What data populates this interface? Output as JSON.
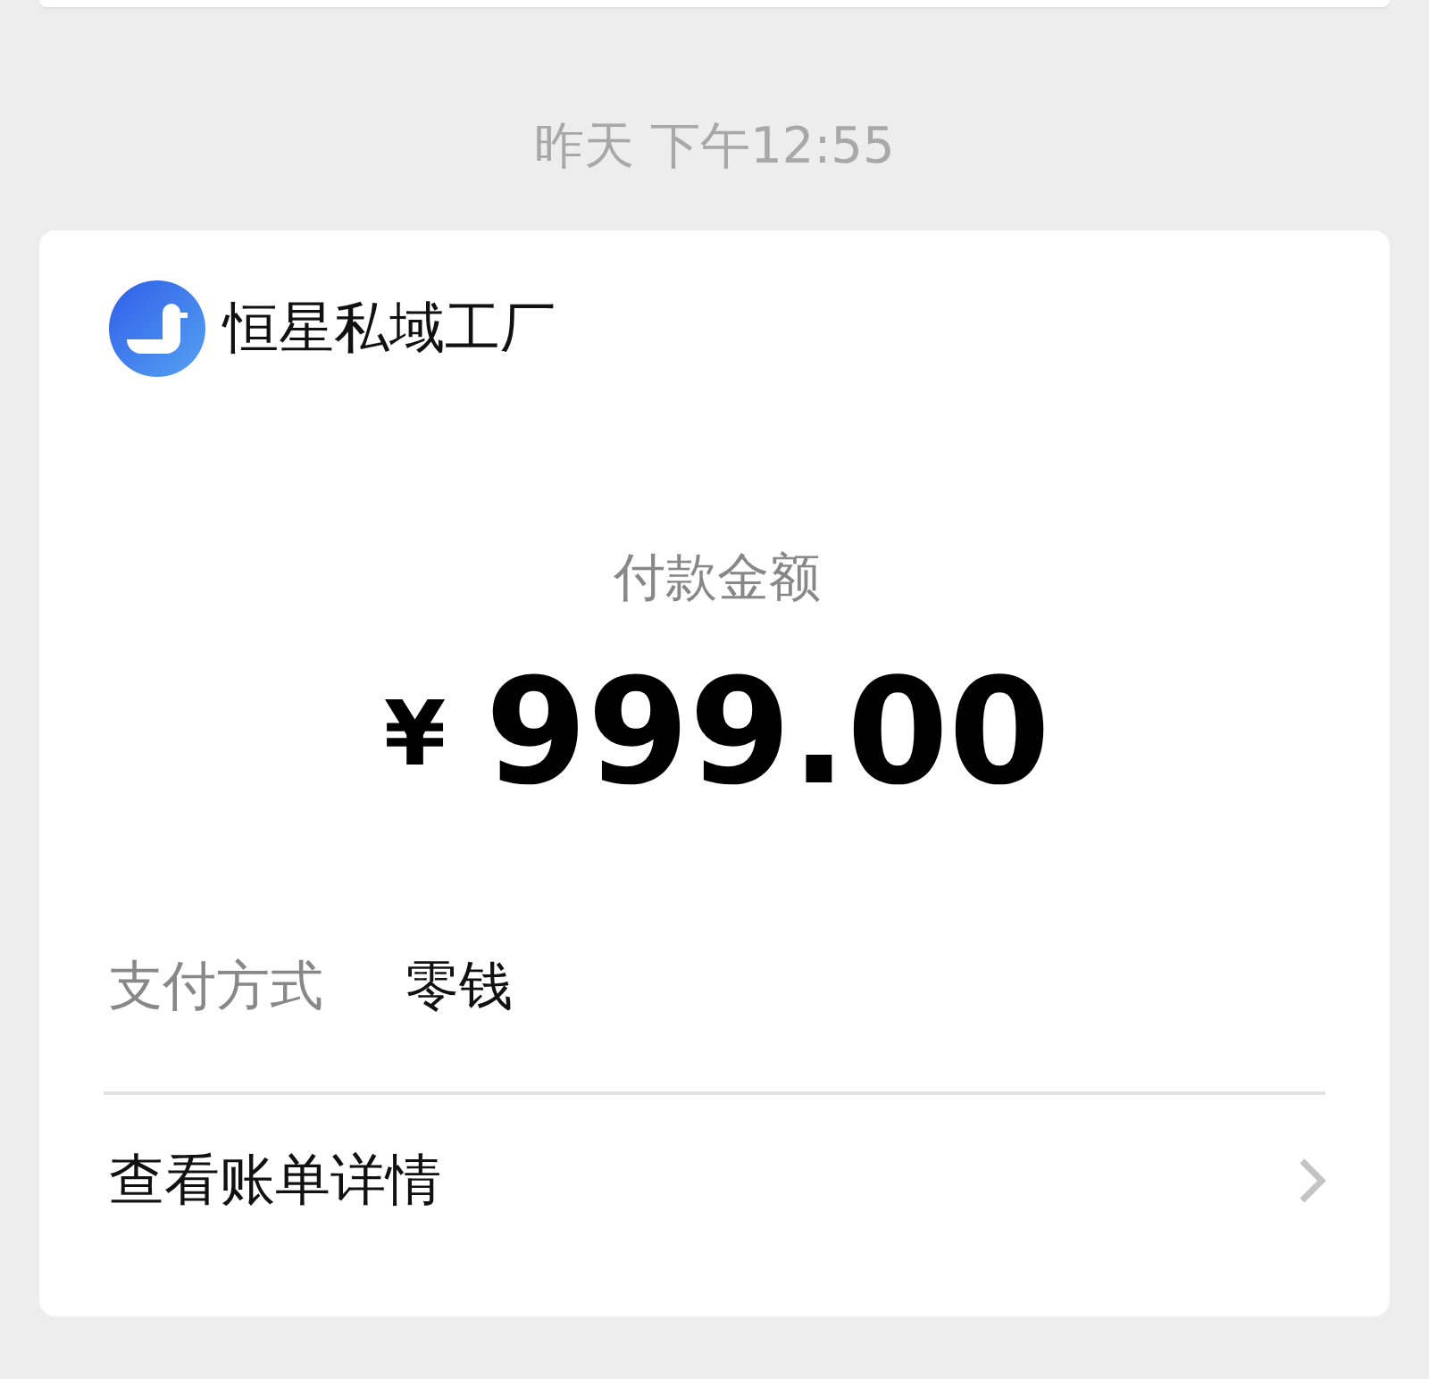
{
  "timestamp": "昨天 下午12:55",
  "card": {
    "merchant": "恒星私域工厂",
    "amount_label": "付款金额",
    "currency": "¥",
    "amount": "999.00",
    "details": [
      {
        "label": "支付方式",
        "value": "零钱"
      }
    ],
    "link": "查看账单详情"
  }
}
